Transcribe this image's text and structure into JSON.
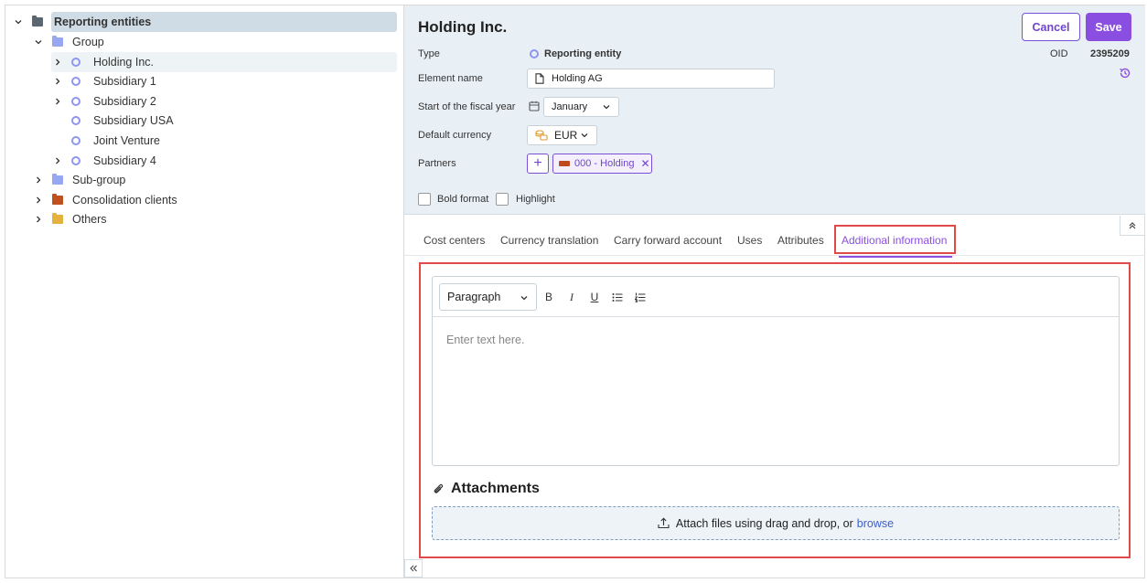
{
  "tree": {
    "root": {
      "label": "Reporting entities"
    },
    "items": [
      {
        "label": "Group"
      },
      {
        "label": "Holding Inc."
      },
      {
        "label": "Subsidiary 1"
      },
      {
        "label": "Subsidiary 2"
      },
      {
        "label": "Subsidiary USA"
      },
      {
        "label": "Joint Venture"
      },
      {
        "label": "Subsidiary 4"
      },
      {
        "label": "Sub-group"
      },
      {
        "label": "Consolidation clients"
      },
      {
        "label": "Others"
      }
    ],
    "colors": {
      "root_folder": "#5c6670",
      "group_folder": "#97a7f2",
      "consolidation_folder": "#c0501e",
      "others_folder": "#e5b33d",
      "entity_ring": "#8e96ef"
    }
  },
  "header": {
    "title": "Holding Inc.",
    "cancel_label": "Cancel",
    "save_label": "Save",
    "oid_label": "OID",
    "oid_value": "2395209"
  },
  "form": {
    "type_label": "Type",
    "type_value": "Reporting entity",
    "element_name_label": "Element name",
    "element_name_value": "Holding AG",
    "fiscal_year_label": "Start of the fiscal year",
    "fiscal_year_value": "January",
    "currency_label": "Default currency",
    "currency_value": "EUR",
    "partners_label": "Partners",
    "partner_add": "+",
    "partner_chip": "000 - Holding",
    "bold_label": "Bold format",
    "highlight_label": "Highlight"
  },
  "tabs": [
    {
      "label": "Cost centers"
    },
    {
      "label": "Currency translation"
    },
    {
      "label": "Carry forward account"
    },
    {
      "label": "Uses"
    },
    {
      "label": "Attributes"
    },
    {
      "label": "Additional information"
    }
  ],
  "editor": {
    "paragraph_label": "Paragraph",
    "bold_btn": "B",
    "italic_btn": "I",
    "underline_btn": "U",
    "placeholder": "Enter text here."
  },
  "attachments": {
    "title": "Attachments",
    "dropzone_text": "Attach files using drag and drop, or",
    "browse_label": "browse"
  },
  "colors": {
    "accent": "#8a4fe0",
    "highlight_box": "#e24a4a",
    "form_bg": "#e8f0f6",
    "link": "#3d5fd1"
  }
}
